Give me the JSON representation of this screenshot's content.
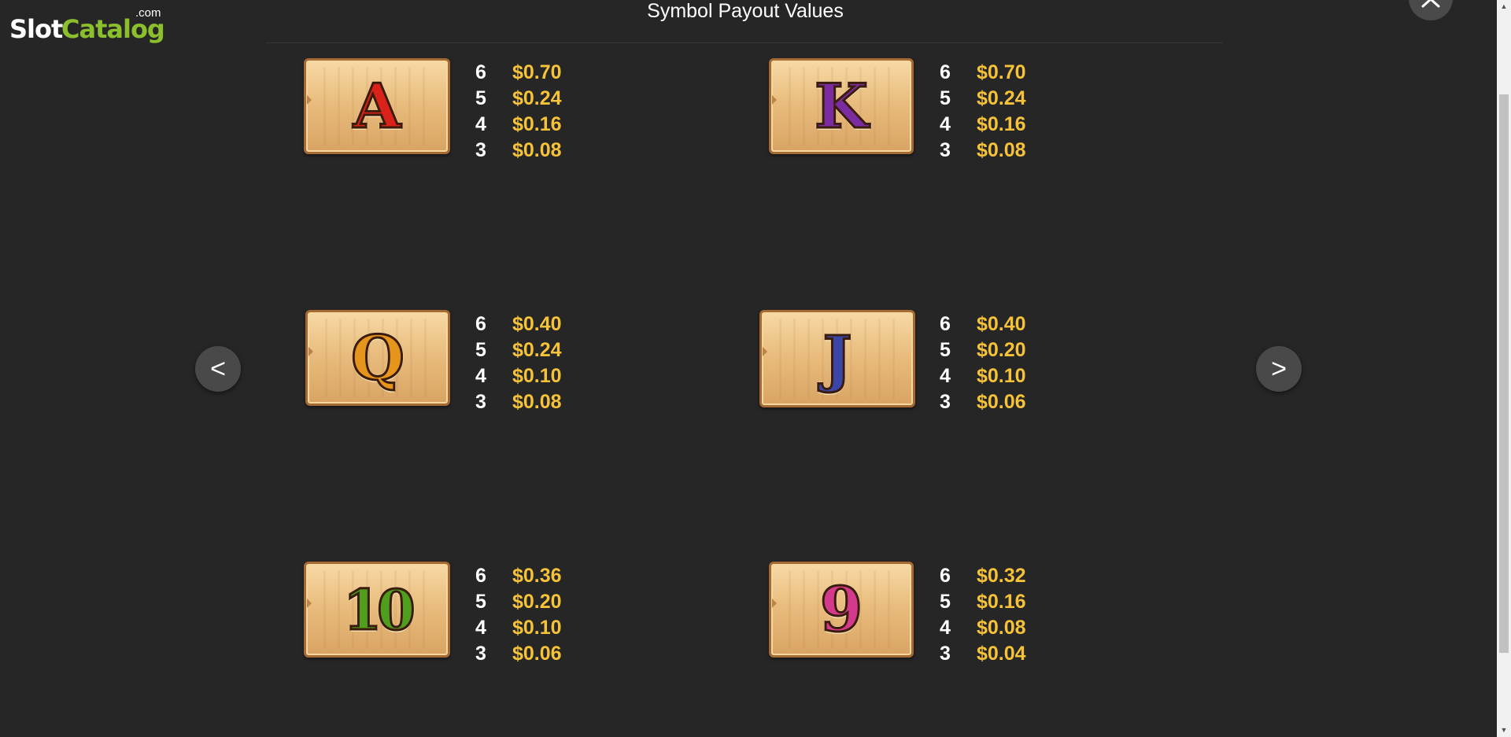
{
  "logo": {
    "part1": "Slot",
    "part2": "Catalog",
    "suffix": ".com"
  },
  "header": {
    "title": "Symbol Payout Values"
  },
  "nav": {
    "prev_label": "<",
    "next_label": ">"
  },
  "colors": {
    "background": "#272627",
    "payout_value": "#f5c238",
    "logo_green": "#8cbf2c"
  },
  "symbols": [
    {
      "glyph": "A",
      "glyph_color": "#d8221a",
      "payouts": [
        {
          "count": "6",
          "value": "$0.70"
        },
        {
          "count": "5",
          "value": "$0.24"
        },
        {
          "count": "4",
          "value": "$0.16"
        },
        {
          "count": "3",
          "value": "$0.08"
        }
      ]
    },
    {
      "glyph": "K",
      "glyph_color": "#7a2ca0",
      "payouts": [
        {
          "count": "6",
          "value": "$0.70"
        },
        {
          "count": "5",
          "value": "$0.24"
        },
        {
          "count": "4",
          "value": "$0.16"
        },
        {
          "count": "3",
          "value": "$0.08"
        }
      ]
    },
    {
      "glyph": "Q",
      "glyph_color": "#e6951c",
      "payouts": [
        {
          "count": "6",
          "value": "$0.40"
        },
        {
          "count": "5",
          "value": "$0.24"
        },
        {
          "count": "4",
          "value": "$0.10"
        },
        {
          "count": "3",
          "value": "$0.08"
        }
      ]
    },
    {
      "glyph": "J",
      "glyph_color": "#3a47a8",
      "payouts": [
        {
          "count": "6",
          "value": "$0.40"
        },
        {
          "count": "5",
          "value": "$0.20"
        },
        {
          "count": "4",
          "value": "$0.10"
        },
        {
          "count": "3",
          "value": "$0.06"
        }
      ]
    },
    {
      "glyph": "10",
      "glyph_color": "#4f9e1e",
      "payouts": [
        {
          "count": "6",
          "value": "$0.36"
        },
        {
          "count": "5",
          "value": "$0.20"
        },
        {
          "count": "4",
          "value": "$0.10"
        },
        {
          "count": "3",
          "value": "$0.06"
        }
      ]
    },
    {
      "glyph": "9",
      "glyph_color": "#d43a8c",
      "payouts": [
        {
          "count": "6",
          "value": "$0.32"
        },
        {
          "count": "5",
          "value": "$0.16"
        },
        {
          "count": "4",
          "value": "$0.08"
        },
        {
          "count": "3",
          "value": "$0.04"
        }
      ]
    }
  ]
}
